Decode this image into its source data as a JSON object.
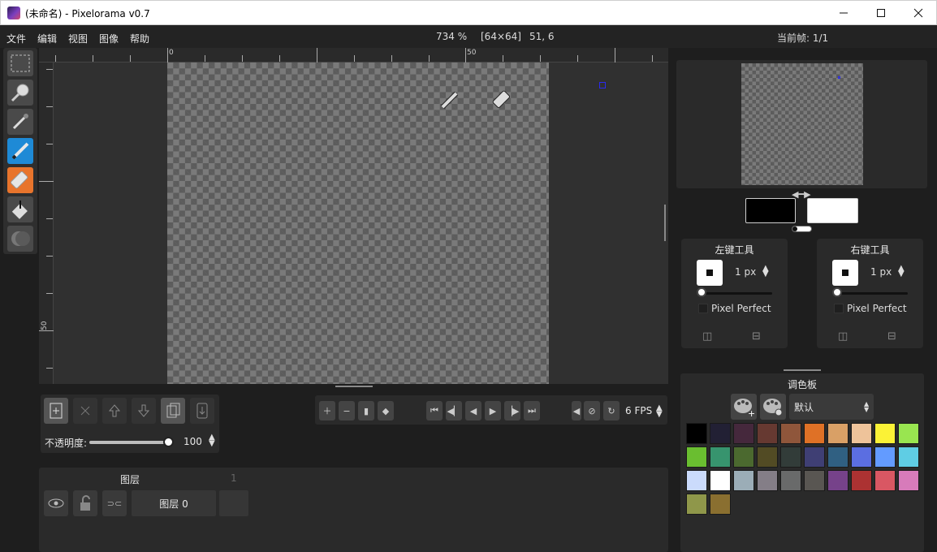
{
  "window": {
    "title": "(未命名) - Pixelorama v0.7",
    "min_icon": "minimize-icon",
    "max_icon": "maximize-icon",
    "close_icon": "close-icon"
  },
  "menu": {
    "items": [
      "文件",
      "编辑",
      "视图",
      "图像",
      "帮助"
    ]
  },
  "status": {
    "zoom": "734 %",
    "canvas_size": "[64×64]",
    "cursor_pos": "51, 6",
    "current_frame": "当前帧: 1/1"
  },
  "tools": [
    {
      "name": "rect-select-icon"
    },
    {
      "name": "zoom-icon"
    },
    {
      "name": "color-picker-icon"
    },
    {
      "name": "pencil-icon",
      "selected": "left"
    },
    {
      "name": "eraser-icon",
      "selected": "right"
    },
    {
      "name": "bucket-icon"
    },
    {
      "name": "lighten-darken-icon"
    }
  ],
  "rulers": {
    "top_labels": [
      "0",
      "50"
    ],
    "left_labels": [
      "50"
    ]
  },
  "canvas": {
    "colors": {
      "check_light": "#7a7a7a",
      "check_dark": "#5c5c5c",
      "cursor": "#2a2af0"
    }
  },
  "layer_actions": {
    "opacity_label": "不透明度:",
    "opacity_value": "100"
  },
  "animation": {
    "fps_label": "6 FPS"
  },
  "layers": {
    "header": "图层",
    "frame_number": "1",
    "items": [
      {
        "name": "图层 0"
      }
    ]
  },
  "colors": {
    "left": "#000000",
    "right": "#ffffff"
  },
  "left_tool": {
    "title": "左键工具",
    "brush_size": "1 px",
    "pixel_perfect": "Pixel Perfect"
  },
  "right_tool": {
    "title": "右键工具",
    "brush_size": "1 px",
    "pixel_perfect": "Pixel Perfect"
  },
  "palette": {
    "title": "调色板",
    "selected": "默认",
    "swatches": [
      "#000000",
      "#222034",
      "#45283c",
      "#663931",
      "#8f563b",
      "#df7126",
      "#d9a066",
      "#eec39a",
      "#fbf236",
      "#99e550",
      "#6abe30",
      "#37946e",
      "#4b692f",
      "#524b24",
      "#323c39",
      "#3f3f74",
      "#306082",
      "#5b6ee1",
      "#639bff",
      "#5fcde4",
      "#cbdbfc",
      "#ffffff",
      "#9badb7",
      "#847e87",
      "#696a6a",
      "#595652",
      "#76428a",
      "#ac3232",
      "#d95763",
      "#d77bba",
      "#8f974a",
      "#8a6f30"
    ]
  }
}
